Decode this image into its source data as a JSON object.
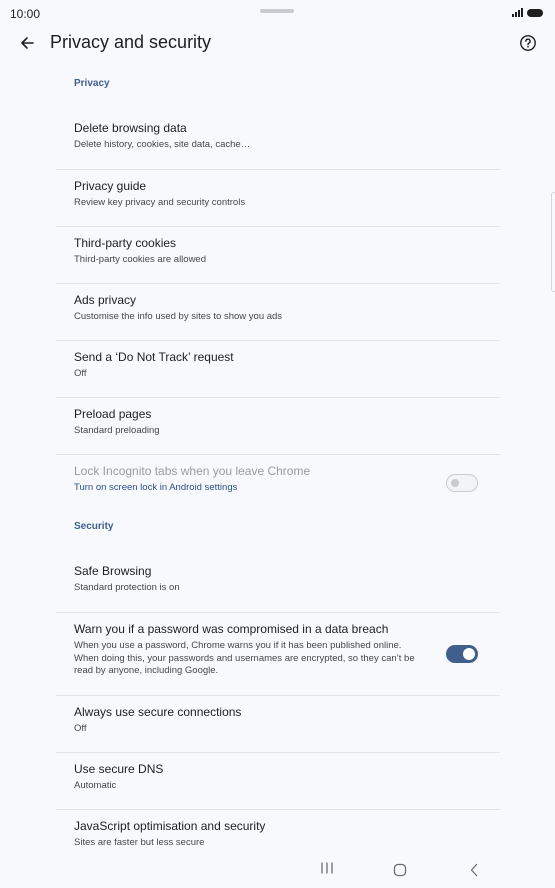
{
  "status_bar": {
    "time": "10:00"
  },
  "app_bar": {
    "title": "Privacy and security",
    "back_icon": "arrow-back-icon",
    "help_icon": "help-circle-icon"
  },
  "privacy_section": {
    "header": "Privacy",
    "items": [
      {
        "title": "Delete browsing data",
        "summary": "Delete history, cookies, site data, cache…"
      },
      {
        "title": "Privacy guide",
        "summary": "Review key privacy and security controls"
      },
      {
        "title": "Third-party cookies",
        "summary": "Third-party cookies are allowed"
      },
      {
        "title": "Ads privacy",
        "summary": "Customise the info used by sites to show you ads"
      },
      {
        "title": "Send a ‘Do Not Track’ request",
        "summary": "Off"
      },
      {
        "title": "Preload pages",
        "summary": "Standard preloading"
      },
      {
        "title": "Lock Incognito tabs when you leave Chrome",
        "summary": "Turn on screen lock in Android settings",
        "enabled": false,
        "toggle_on": false
      }
    ]
  },
  "security_section": {
    "header": "Security",
    "items": [
      {
        "title": "Safe Browsing",
        "summary": "Standard protection is on"
      },
      {
        "title": "Warn you if a password was compromised in a data breach",
        "summary": "When you use a password, Chrome warns you if it has been published online. When doing this, your passwords and usernames are encrypted, so they can’t be read by anyone, including Google.",
        "toggle_on": true
      },
      {
        "title": "Always use secure connections",
        "summary": "Off"
      },
      {
        "title": "Use secure DNS",
        "summary": "Automatic"
      },
      {
        "title": "JavaScript optimisation and security",
        "summary": "Sites are faster but less secure"
      }
    ]
  },
  "nav_bar": {
    "recents_icon": "recents-icon",
    "home_icon": "home-icon",
    "back_icon": "nav-back-icon"
  },
  "colors": {
    "accent": "#3f5f8c",
    "background": "#f8f9fc",
    "link": "#2c4f87",
    "divider": "#e3e4e8"
  }
}
